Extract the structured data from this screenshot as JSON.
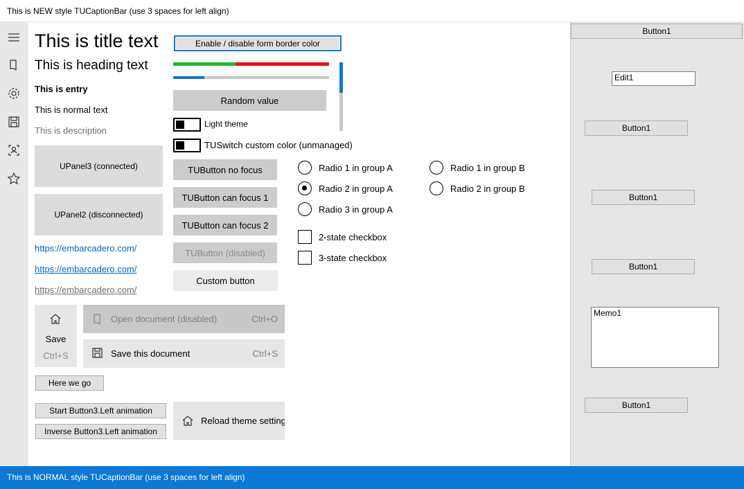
{
  "caption_top": {
    "title": "This is NEW style TUCaptionBar (use 3 spaces for left align)"
  },
  "caption_bottom": {
    "title": "This is NORMAL style TUCaptionBar (use 3 spaces for left align)"
  },
  "sidebar": {
    "icons": [
      "hamburger-icon",
      "document-icon",
      "gear-icon",
      "save-icon",
      "person-frame-icon",
      "star-icon"
    ]
  },
  "texts": {
    "title": "This is title text",
    "heading": "This is heading text",
    "entry": "This is entry",
    "normal": "This is normal text",
    "description": "This is description"
  },
  "panels": {
    "panel3": "UPanel3 (connected)",
    "panel2": "UPanel2 (disconnected)"
  },
  "links": [
    "https://embarcadero.com/",
    "https://embarcadero.com/",
    "https://embarcadero.com/"
  ],
  "form_border_button": "Enable / disable form border color",
  "progress": {
    "bar1_green": 0.4,
    "bar2_blue": 0.2,
    "scroll_position": 0.45
  },
  "random_button": "Random value",
  "switches": {
    "light_theme": "Light theme",
    "custom_color": "TUSwitch custom color (unmanaged)"
  },
  "tubuttons": {
    "no_focus": "TUButton no focus",
    "can_focus_1": "TUButton can focus 1",
    "can_focus_2": "TUButton can focus 2",
    "disabled": "TUButton (disabled)",
    "custom": "Custom button"
  },
  "radios": {
    "group_a": [
      "Radio 1 in group A",
      "Radio 2 in group A",
      "Radio 3 in group A"
    ],
    "group_b": [
      "Radio 1 in group B",
      "Radio 2 in group B"
    ],
    "selected": "Radio 2 in group A"
  },
  "checkboxes": [
    "2-state checkbox",
    "3-state checkbox"
  ],
  "save_tile": {
    "label": "Save",
    "shortcut": "Ctrl+S"
  },
  "symbol_buttons": {
    "open": {
      "label": "Open document (disabled)",
      "shortcut": "Ctrl+O"
    },
    "save": {
      "label": "Save this document",
      "shortcut": "Ctrl+S"
    },
    "reload": {
      "label": "Reload theme setting"
    }
  },
  "std_buttons": {
    "here_we_go": "Here we go",
    "start_anim": "Start Button3.Left animation",
    "inverse_anim": "Inverse Button3.Left animation"
  },
  "right_panel": {
    "button_top": "Button1",
    "edit": "Edit1",
    "buttons": [
      "Button1",
      "Button1",
      "Button1",
      "Button1"
    ],
    "memo": "Memo1"
  },
  "colors": {
    "accent": "#0a78d4",
    "progress_green": "#1db73a",
    "progress_red": "#e81123",
    "link": "#0067c0"
  }
}
